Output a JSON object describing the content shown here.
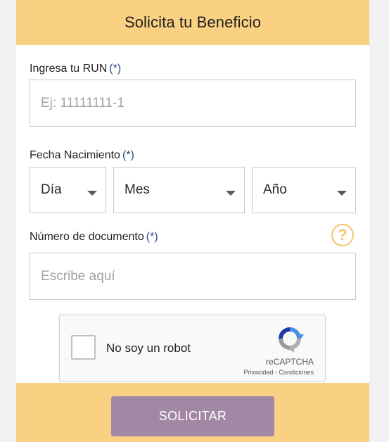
{
  "header": {
    "title": "Solicita tu Beneficio"
  },
  "run": {
    "label": "Ingresa tu RUN",
    "required": "(*)",
    "placeholder": "Ej: 11111111-1"
  },
  "birth": {
    "label": "Fecha Nacimiento",
    "required": "(*)",
    "day": "Día",
    "month": "Mes",
    "year": "Año"
  },
  "document": {
    "label": "Número de documento",
    "required": "(*)",
    "placeholder": "Escribe aquí",
    "help_icon": "question-circle-icon"
  },
  "captcha": {
    "label": "No soy un robot",
    "brand": "reCAPTCHA",
    "links": "Privacidad - Condiciones"
  },
  "submit": {
    "label": "SOLICITAR"
  },
  "colors": {
    "header_bg": "#fad182",
    "button_bg": "#a388a6",
    "help_icon": "#f5c66a"
  }
}
